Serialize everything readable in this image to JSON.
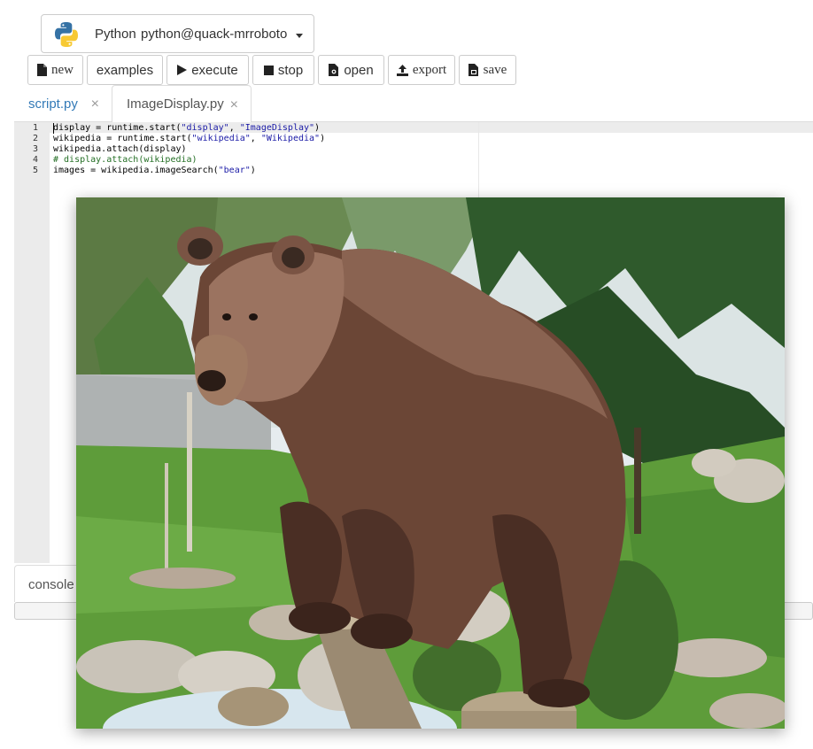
{
  "runtime": {
    "language": "Python",
    "name": "python@quack-mrroboto",
    "icon": "python-logo-icon"
  },
  "toolbar": {
    "new_label": "new",
    "examples_label": "examples",
    "execute_label": "execute",
    "stop_label": "stop",
    "open_label": "open",
    "export_label": "export",
    "save_label": "save"
  },
  "tabs": [
    {
      "label": "script.py",
      "close": "×",
      "active": false
    },
    {
      "label": "ImageDisplay.py",
      "close": "×",
      "active": true
    }
  ],
  "editor": {
    "line_numbers": [
      "1",
      "2",
      "3",
      "4",
      "5"
    ],
    "lines": [
      {
        "pre": "display = runtime.start(",
        "s1": "\"display\"",
        "mid": ", ",
        "s2": "\"ImageDisplay\"",
        "post": ")"
      },
      {
        "pre": "wikipedia = runtime.start(",
        "s1": "\"wikipedia\"",
        "mid": ", ",
        "s2": "\"Wikipedia\"",
        "post": ")"
      },
      {
        "text": "wikipedia.attach(display)"
      },
      {
        "comment": "# display.attach(wikipedia)"
      },
      {
        "pre": "images = wikipedia.imageSearch(",
        "s1": "\"bear\"",
        "post": ")"
      }
    ]
  },
  "console": {
    "tab_label": "console"
  },
  "image_display": {
    "subject": "brown bear standing on a log",
    "colors": {
      "sky": "#e6ecef",
      "tree_dark": "#2f5a2c",
      "grass": "#5e9c3a",
      "bear": "#6b4636",
      "rock": "#c9c3b8",
      "water": "#d7e6ee"
    }
  }
}
